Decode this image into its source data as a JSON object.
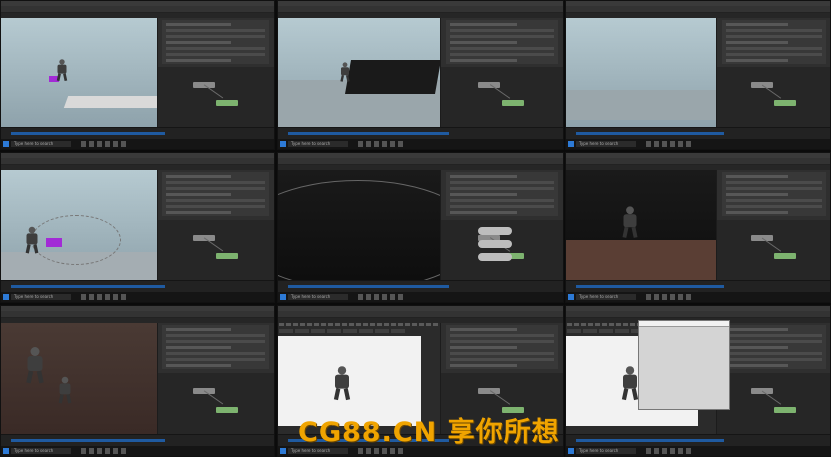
{
  "watermark": {
    "text": "CG88.CN 享你所想",
    "color": "#f0a400"
  },
  "taskbar": {
    "search_placeholder": "Type here to search",
    "start_color": "#2d7ad6"
  },
  "colors": {
    "viewport_sky": "#b6cad1",
    "highlight_purple": "#a22bd6",
    "timeline_blue": "#1f5aa0",
    "panel_bg": "#2b2b2b"
  },
  "tiles": [
    {
      "viewport": "blue",
      "content": "robot-with-purple-box"
    },
    {
      "viewport": "blue",
      "content": "dark-particle-plane"
    },
    {
      "viewport": "blue",
      "content": "horizon-view"
    },
    {
      "viewport": "blue",
      "content": "robot-with-arc"
    },
    {
      "viewport": "dark",
      "content": "dark-sphere-view"
    },
    {
      "viewport": "dark",
      "content": "robot-dark-floor"
    },
    {
      "viewport": "brown",
      "content": "robot-brown"
    },
    {
      "viewport": "render",
      "content": "render-view"
    },
    {
      "viewport": "render",
      "content": "render-with-dialog"
    }
  ]
}
